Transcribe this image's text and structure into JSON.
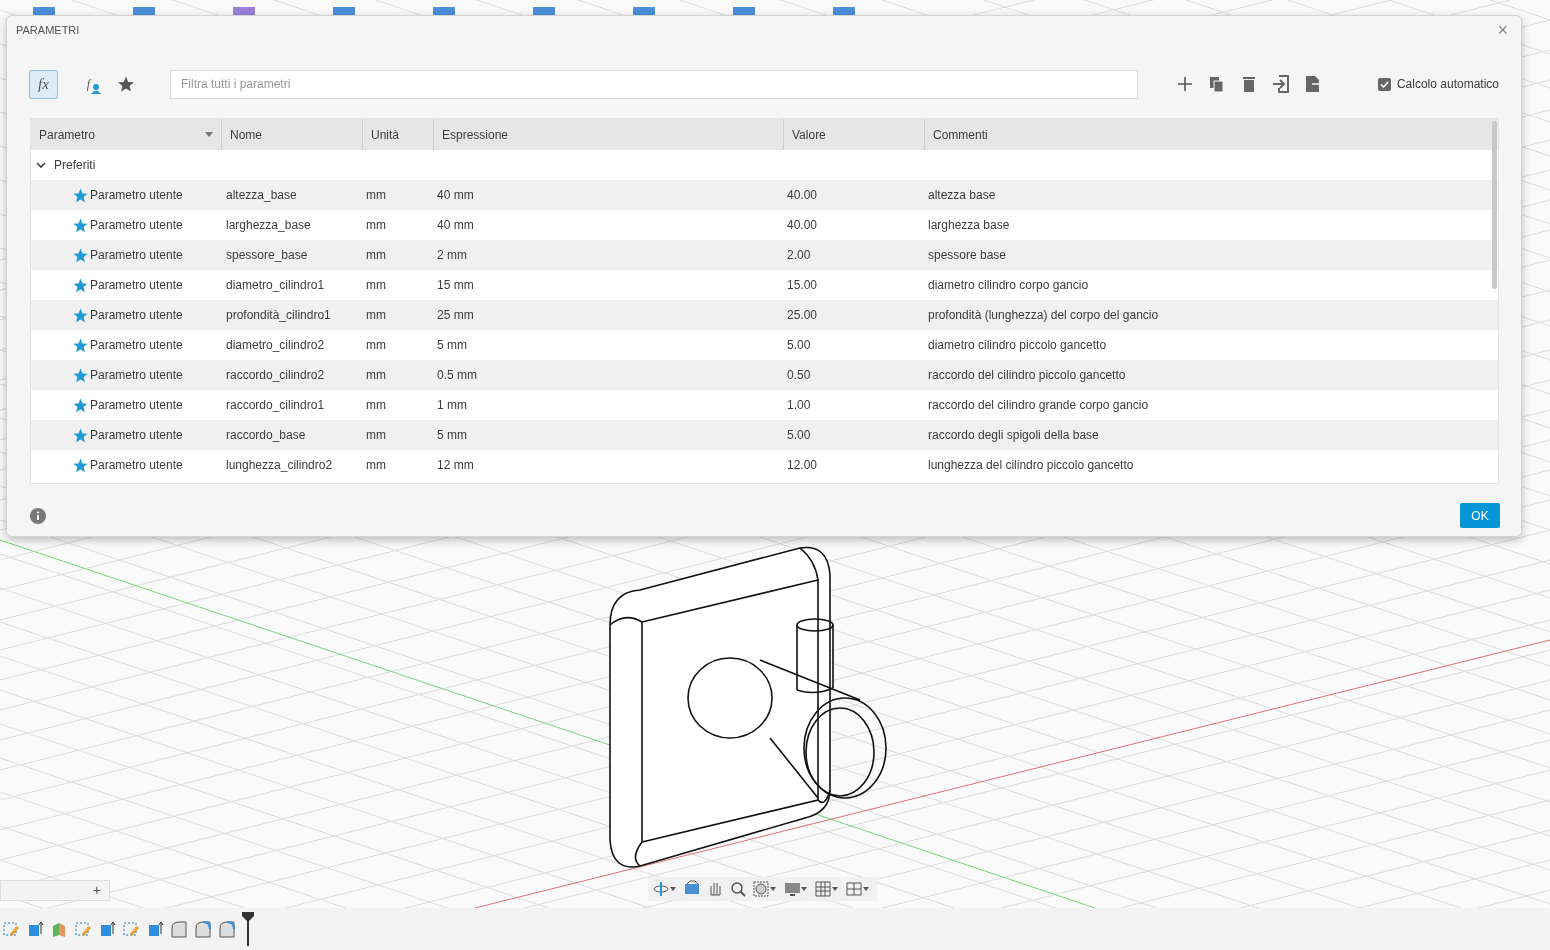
{
  "dialog": {
    "title": "PARAMETRI",
    "close": "×"
  },
  "view_tools": [
    {
      "kind": "fx",
      "label": "fx",
      "selected": true
    },
    {
      "kind": "user",
      "label": "f",
      "selected": false
    },
    {
      "kind": "favorites",
      "selected": false
    }
  ],
  "filter": {
    "placeholder": "Filtra tutti i parametri"
  },
  "auto_calc": {
    "label": "Calcolo automatico",
    "checked": true
  },
  "table": {
    "columns": [
      "Parametro",
      "Nome",
      "Unità",
      "Espressione",
      "Valore",
      "Commenti"
    ],
    "groups": [
      {
        "label": "Preferiti",
        "expanded": true,
        "rows": [
          {
            "favorite": true,
            "type": "Parametro utente",
            "name": "altezza_base",
            "unit": "mm",
            "expression": "40 mm",
            "value": "40.00",
            "comment": "altezza base"
          },
          {
            "favorite": true,
            "type": "Parametro utente",
            "name": "larghezza_base",
            "unit": "mm",
            "expression": "40 mm",
            "value": "40.00",
            "comment": "larghezza base"
          },
          {
            "favorite": true,
            "type": "Parametro utente",
            "name": "spessore_base",
            "unit": "mm",
            "expression": "2 mm",
            "value": "2.00",
            "comment": "spessore base"
          },
          {
            "favorite": true,
            "type": "Parametro utente",
            "name": "diametro_cilindro1",
            "unit": "mm",
            "expression": "15 mm",
            "value": "15.00",
            "comment": "diametro cilindro corpo gancio"
          },
          {
            "favorite": true,
            "type": "Parametro utente",
            "name": "profondità_cilindro1",
            "unit": "mm",
            "expression": "25 mm",
            "value": "25.00",
            "comment": "profondità (lunghezza) del corpo del gancio"
          },
          {
            "favorite": true,
            "type": "Parametro utente",
            "name": "diametro_cilindro2",
            "unit": "mm",
            "expression": "5 mm",
            "value": "5.00",
            "comment": "diametro cilindro piccolo gancetto"
          },
          {
            "favorite": true,
            "type": "Parametro utente",
            "name": "raccordo_cilindro2",
            "unit": "mm",
            "expression": "0.5 mm",
            "value": "0.50",
            "comment": "raccordo del cilindro piccolo gancetto"
          },
          {
            "favorite": true,
            "type": "Parametro utente",
            "name": "raccordo_cilindro1",
            "unit": "mm",
            "expression": "1 mm",
            "value": "1.00",
            "comment": "raccordo del cilindro grande corpo gancio"
          },
          {
            "favorite": true,
            "type": "Parametro utente",
            "name": "raccordo_base",
            "unit": "mm",
            "expression": "5 mm",
            "value": "5.00",
            "comment": "raccordo degli spigoli della base"
          },
          {
            "favorite": true,
            "type": "Parametro utente",
            "name": "lunghezza_cilindro2",
            "unit": "mm",
            "expression": "12 mm",
            "value": "12.00",
            "comment": "lunghezza del cilindro piccolo gancetto"
          }
        ]
      }
    ]
  },
  "ok_button": "OK",
  "browser_panel": {
    "add": "+"
  }
}
